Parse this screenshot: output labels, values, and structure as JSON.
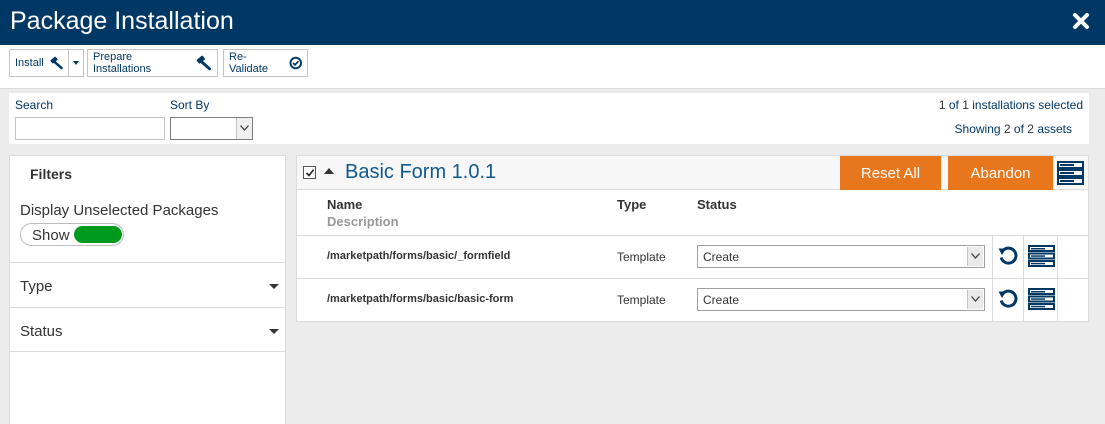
{
  "window": {
    "title": "Package Installation",
    "close_icon": "close-icon"
  },
  "toolbar": {
    "install_label": "Install",
    "prepare_label": "Prepare Installations",
    "revalidate_label": "Re-Validate"
  },
  "search": {
    "label": "Search",
    "value": "",
    "sort_label": "Sort By",
    "sort_value": "",
    "selection_count": "1",
    "selection_mid": "of",
    "selection_total": "1",
    "selection_suffix": "installations selected",
    "showing_prefix": "Showing",
    "showing_count": "2",
    "showing_mid": "of",
    "showing_total": "2",
    "showing_suffix": "assets"
  },
  "filters": {
    "heading": "Filters",
    "display_label": "Display Unselected Packages",
    "toggle_label": "Show",
    "toggle_on": true,
    "type_label": "Type",
    "status_label": "Status"
  },
  "package": {
    "checked": true,
    "title": "Basic Form 1.0.1",
    "reset_label": "Reset All",
    "abandon_label": "Abandon",
    "columns": {
      "name": "Name",
      "description": "Description",
      "type": "Type",
      "status": "Status"
    },
    "rows": [
      {
        "path": "/marketpath/forms/basic/_formfield",
        "type": "Template",
        "status": "Create"
      },
      {
        "path": "/marketpath/forms/basic/basic-form",
        "type": "Template",
        "status": "Create"
      }
    ]
  },
  "colors": {
    "header_bg": "#003865",
    "accent_orange": "#e8761c",
    "toggle_green": "#009a1e",
    "link_blue": "#0f5a8d"
  }
}
